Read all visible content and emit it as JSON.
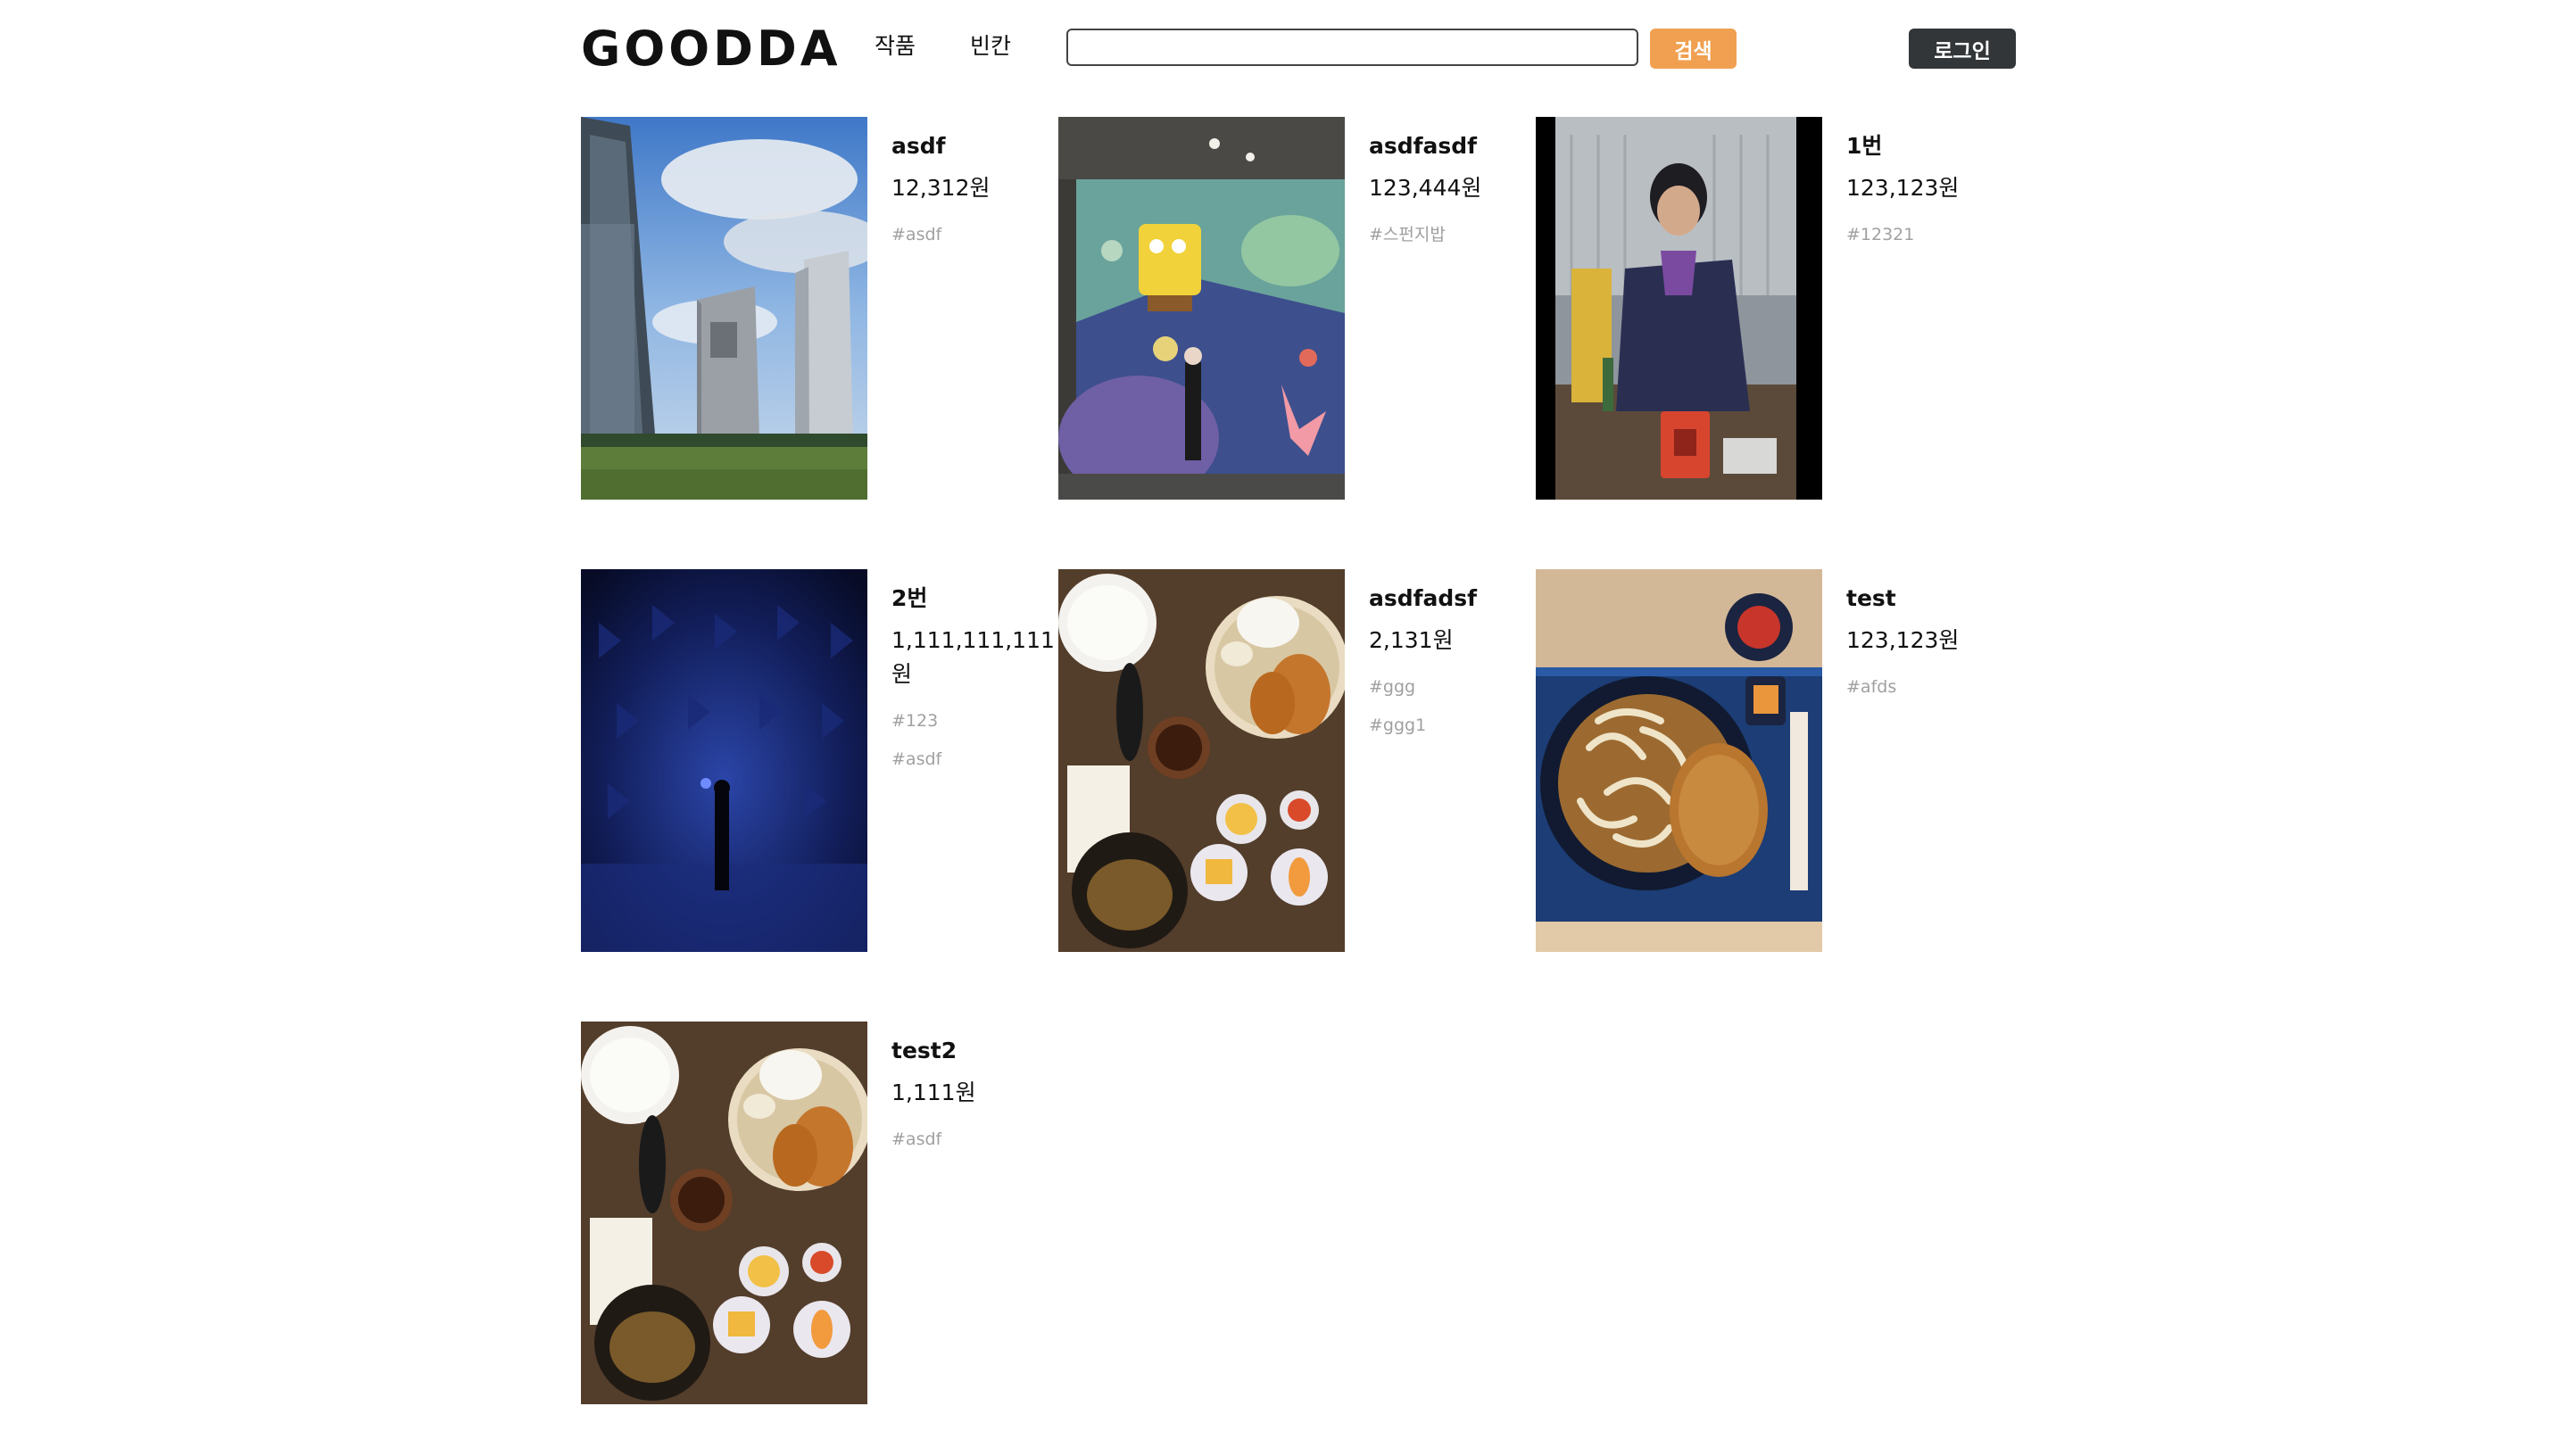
{
  "header": {
    "logo": "GOODDA",
    "nav": {
      "works": "작품",
      "blank": "빈칸"
    },
    "search": {
      "value": "",
      "placeholder": "",
      "button_label": "검색"
    },
    "login_label": "로그인"
  },
  "products": [
    {
      "title": "asdf",
      "price": "12,312원",
      "tags": [
        "#asdf"
      ],
      "image": "city-buildings-photo"
    },
    {
      "title": "asdfasdf",
      "price": "123,444원",
      "tags": [
        "#스펀지밥"
      ],
      "image": "spongebob-mural-photo"
    },
    {
      "title": "1번",
      "price": "123,123원",
      "tags": [
        "#12321"
      ],
      "image": "person-at-desk-photo"
    },
    {
      "title": "2번",
      "price": "1,111,111,111원",
      "tags": [
        "#123",
        "#asdf"
      ],
      "image": "blue-room-photo"
    },
    {
      "title": "asdfadsf",
      "price": "2,131원",
      "tags": [
        "#ggg",
        "#ggg1"
      ],
      "image": "set-meal-photo"
    },
    {
      "title": "test",
      "price": "123,123원",
      "tags": [
        "#afds"
      ],
      "image": "udon-katsu-photo"
    },
    {
      "title": "test2",
      "price": "1,111원",
      "tags": [
        "#asdf"
      ],
      "image": "set-meal-photo"
    }
  ],
  "colors": {
    "search_button": "#f0a050",
    "login_button": "#333638",
    "tag_text": "#a0a0a0"
  }
}
